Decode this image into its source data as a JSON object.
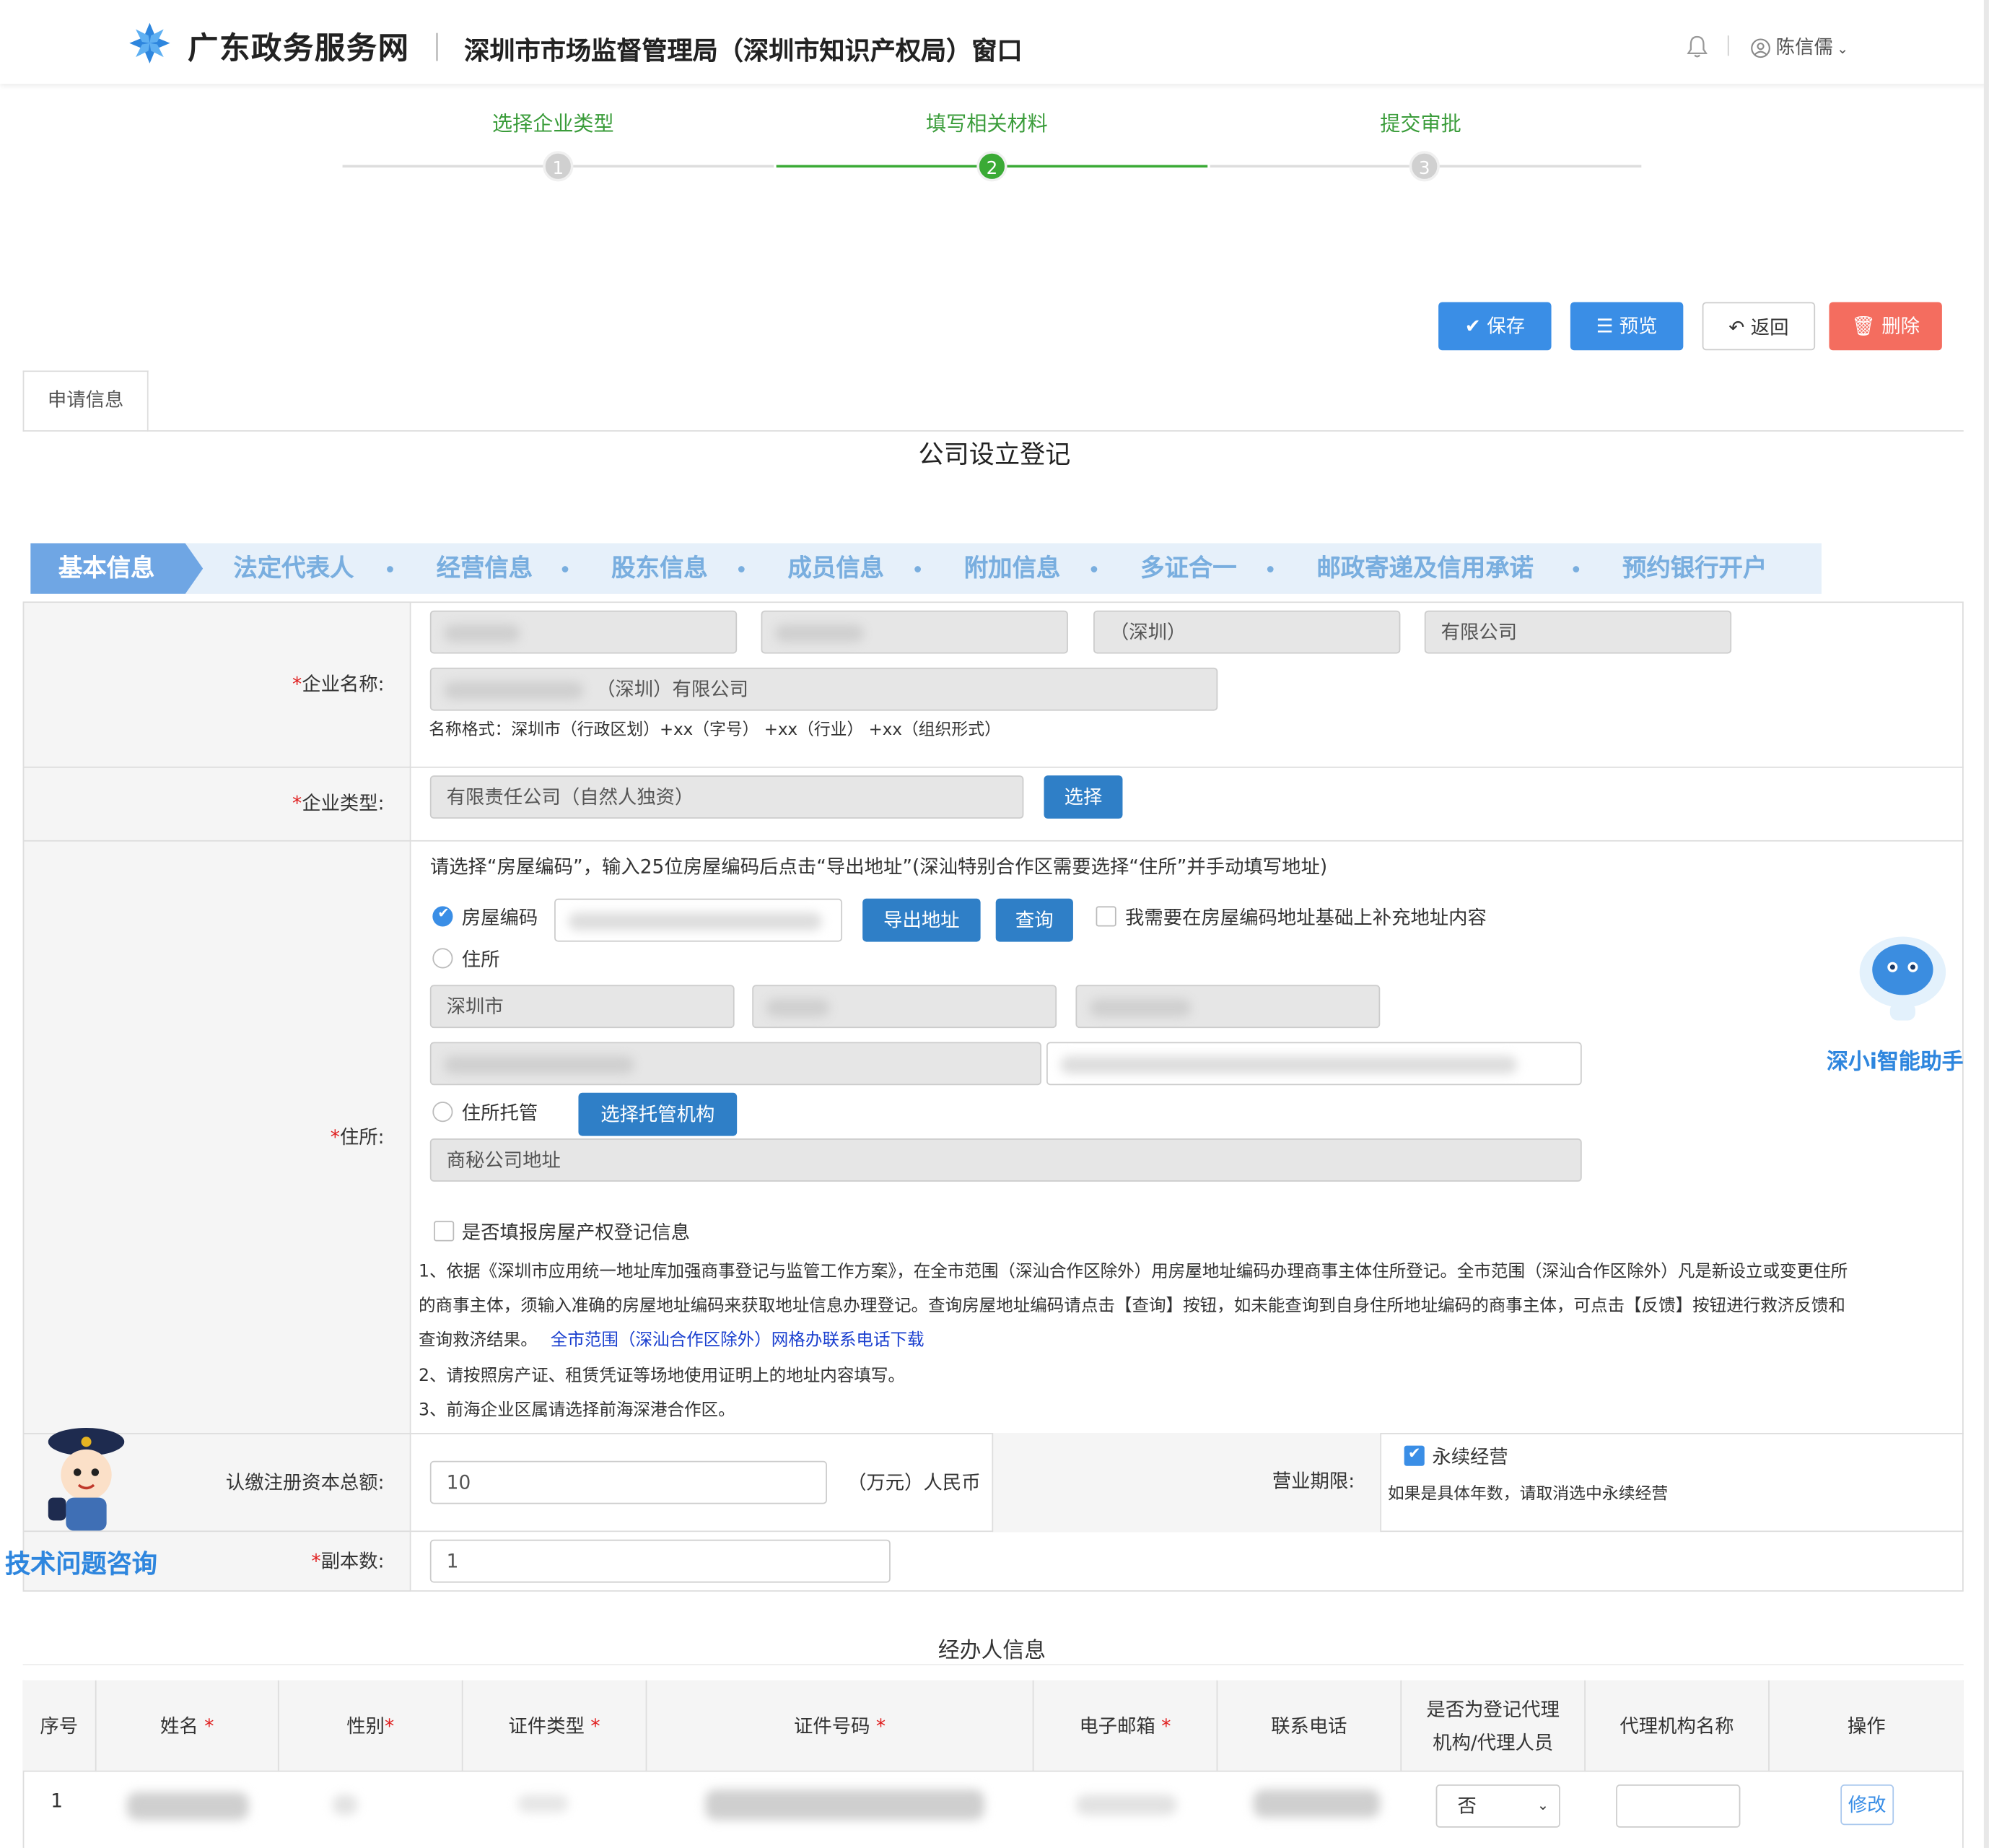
{
  "header": {
    "site_name": "广东政务服务网",
    "window_title": "深圳市市场监督管理局（深圳市知识产权局）窗口",
    "user_name": "陈信儒"
  },
  "steps": [
    {
      "label": "选择企业类型",
      "number": "1"
    },
    {
      "label": "填写相关材料",
      "number": "2"
    },
    {
      "label": "提交审批",
      "number": "3"
    }
  ],
  "toolbar": {
    "save": "保存",
    "preview": "预览",
    "back": "返回",
    "delete": "删除"
  },
  "tab_label": "申请信息",
  "page_title": "公司设立登记",
  "nav": {
    "active": "基本信息",
    "items": [
      "法定代表人",
      "经营信息",
      "股东信息",
      "成员信息",
      "附加信息",
      "多证合一",
      "邮政寄递及信用承诺",
      "预约银行开户"
    ]
  },
  "company_name": {
    "label": "企业名称:",
    "part3": "（深圳）",
    "part4": "有限公司",
    "full_suffix": "（深圳）有限公司",
    "hint": "名称格式：深圳市（行政区划）+xx（字号） +xx（行业） +xx（组织形式）"
  },
  "company_type": {
    "label": "企业类型:",
    "value": "有限责任公司（自然人独资）",
    "button": "选择"
  },
  "address": {
    "label": "住所:",
    "notice": "请选择“房屋编码”，输入25位房屋编码后点击“导出地址”(深汕特别合作区需要选择“住所”并手动填写地址)",
    "opt_house_code": "房屋编码",
    "btn_export": "导出地址",
    "btn_query": "查询",
    "supplement": "我需要在房屋编码地址基础上补充地址内容",
    "opt_residence": "住所",
    "city": "深圳市",
    "opt_trust": "住所托管",
    "btn_trust": "选择托管机构",
    "trust_placeholder": "商秘公司地址",
    "property_reg": "是否填报房屋产权登记信息",
    "note1a": "1、依据《深圳市应用统一地址库加强商事登记与监管工作方案》，在全市范围（深汕合作区除外）用房屋地址编码办理商事主体住所登记。全市范围（深汕合作区除外）凡是新设立或变更住所",
    "note1b": "的商事主体，须输入准确的房屋地址编码来获取地址信息办理登记。查询房屋地址编码请点击【查询】按钮，如未能查询到自身住所地址编码的商事主体，可点击【反馈】按钮进行救济反馈和",
    "note1c": "查询救济结果。",
    "note1_link": "全市范围（深汕合作区除外）网格办联系电话下载",
    "note2": "2、请按照房产证、租赁凭证等场地使用证明上的地址内容填写。",
    "note3": "3、前海企业区属请选择前海深港合作区。"
  },
  "capital": {
    "label": "认缴注册资本总额:",
    "value": "10",
    "unit": "（万元）人民币"
  },
  "term": {
    "label": "营业期限:",
    "perpetual": "永续经营",
    "hint": "如果是具体年数，请取消选中永续经营"
  },
  "copies": {
    "label": "副本数:",
    "value": "1"
  },
  "assistant": {
    "label": "深小i智能助手"
  },
  "tech_support": {
    "label": "技术问题咨询"
  },
  "agent_section": {
    "title": "经办人信息",
    "headers": [
      "序号",
      "姓名",
      "性别",
      "证件类型",
      "证件号码",
      "电子邮箱",
      "联系电话",
      "是否为登记代理机构/代理人员",
      "代理机构名称",
      "操作"
    ],
    "row": {
      "index": "1",
      "is_agent": "否",
      "action": "修改"
    }
  },
  "colors": {
    "accent_blue": "#3a8ee6",
    "step_green": "#3a9c3a",
    "danger": "#f46d5f",
    "hint_red": "#e02020"
  }
}
